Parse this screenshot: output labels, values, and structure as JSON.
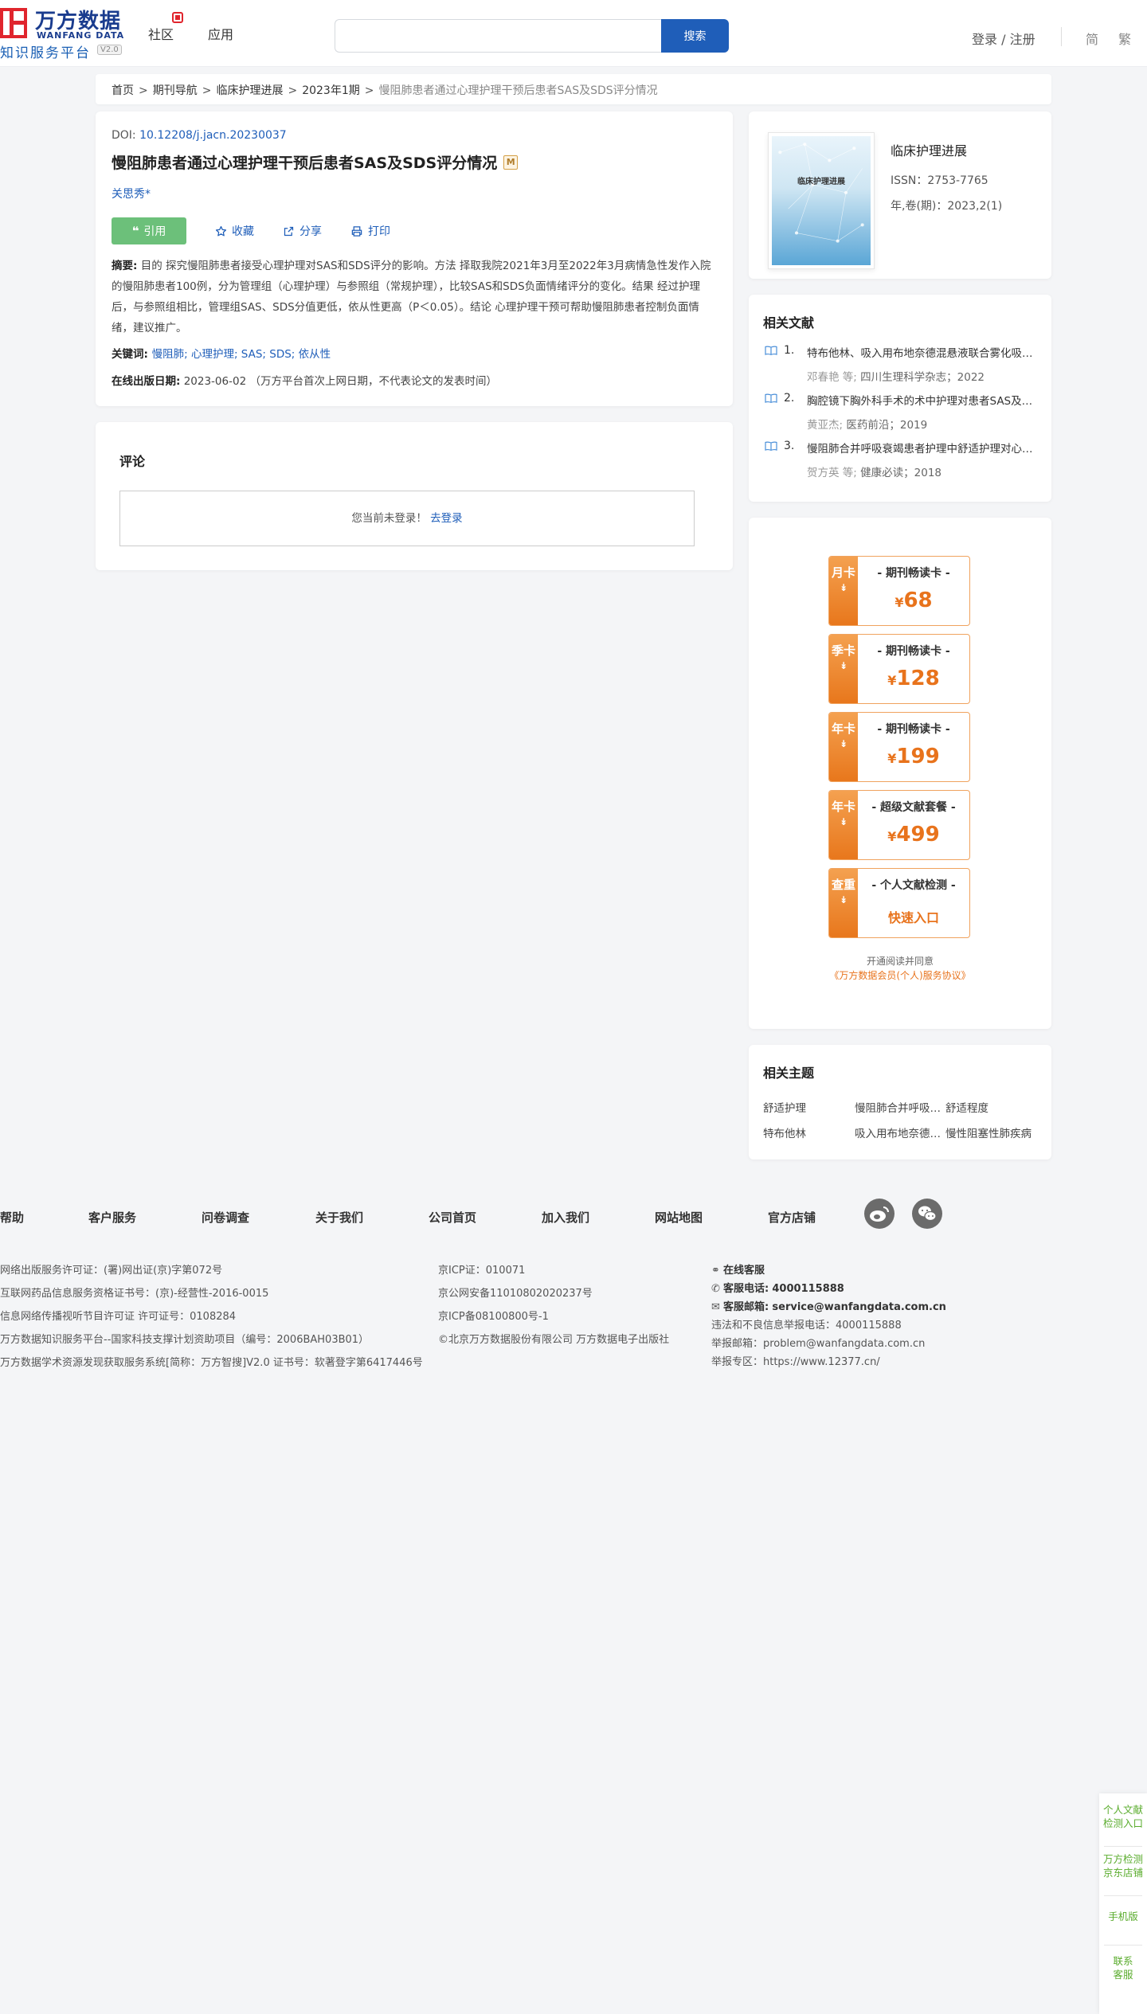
{
  "header": {
    "logo_cn": "万方数据",
    "logo_en": "WANFANG DATA",
    "logo_sub": "知识服务平台",
    "logo_version": "V2.0",
    "nav": [
      "社区",
      "应用"
    ],
    "search_placeholder": "",
    "search_button": "搜索",
    "login": "登录 / 注册",
    "lang_simplified": "简",
    "lang_traditional": "繁"
  },
  "breadcrumb": [
    "首页",
    "期刊导航",
    "临床护理进展",
    "2023年1期",
    "慢阻肺患者通过心理护理干预后患者SAS及SDS评分情况"
  ],
  "article": {
    "doi_label": "DOI: ",
    "doi_value": "10.12208/j.jacn.20230037",
    "title": "慢阻肺患者通过心理护理干预后患者SAS及SDS评分情况",
    "m_badge": "M",
    "author": "关思秀*",
    "cite": "引用",
    "favorite": "收藏",
    "share": "分享",
    "print": "打印",
    "abstract_label": "摘要:",
    "abstract_text": " 目的 探究慢阻肺患者接受心理护理对SAS和SDS评分的影响。方法 择取我院2021年3月至2022年3月病情急性发作入院的慢阻肺患者100例，分为管理组（心理护理）与参照组（常规护理），比较SAS和SDS负面情绪评分的变化。结果 经过护理后，与参照组相比，管理组SAS、SDS分值更低，依从性更高（P＜0.05）。结论 心理护理干预可帮助慢阻肺患者控制负面情绪，建议推广。",
    "keywords_label": "关键词:",
    "keywords": "慢阻肺; 心理护理; SAS; SDS; 依从性",
    "pubdate_label": "在线出版日期:",
    "pubdate_value": "2023-06-02  （万方平台首次上网日期，不代表论文的发表时间）"
  },
  "comment": {
    "title": "评论",
    "notice": "您当前未登录！",
    "login_link": "去登录"
  },
  "journal": {
    "cover_title": "临床护理进展",
    "name": "临床护理进展",
    "issn": "ISSN：2753-7765",
    "volume": "年,卷(期)：2023,2(1)"
  },
  "related_docs": {
    "title": "相关文献",
    "items": [
      {
        "num": "1.",
        "title": "特布他林、吸入用布地奈德混悬液联合雾化吸入治疗慢阻肺",
        "authors": "邓春艳  等;",
        "source": "四川生理科学杂志；2022"
      },
      {
        "num": "2.",
        "title": "胸腔镜下胸外科手术的术中护理对患者SAS及SDS的影响",
        "authors": "黄亚杰;",
        "source": "医药前沿；2019"
      },
      {
        "num": "3.",
        "title": "慢阻肺合并呼吸衰竭患者护理中舒适护理对心理状态的影响",
        "authors": "贺方英  等;",
        "source": "健康必读；2018"
      }
    ]
  },
  "promo": {
    "cards": [
      {
        "side": "月卡",
        "name": "- 期刊畅读卡 -",
        "currency": "¥",
        "price": "68"
      },
      {
        "side": "季卡",
        "name": "- 期刊畅读卡 -",
        "currency": "¥",
        "price": "128"
      },
      {
        "side": "年卡",
        "name": "- 期刊畅读卡 -",
        "currency": "¥",
        "price": "199"
      },
      {
        "side": "年卡",
        "name": "- 超级文献套餐 -",
        "currency": "¥",
        "price": "499"
      },
      {
        "side": "查重",
        "name": "- 个人文献检测 -",
        "quick": "快速入口"
      }
    ],
    "agree_text": "开通阅读并同意",
    "agree_link": "《万方数据会员(个人)服务协议》"
  },
  "topics": {
    "title": "相关主题",
    "items": [
      "舒适护理",
      "慢阻肺合并呼吸衰竭",
      "舒适程度",
      "特布他林",
      "吸入用布地奈德混悬液",
      "慢性阻塞性肺疾病"
    ]
  },
  "footer": {
    "nav": [
      "帮助",
      "客户服务",
      "问卷调查",
      "关于我们",
      "公司首页",
      "加入我们",
      "网站地图",
      "官方店铺"
    ],
    "col1": [
      "网络出版服务许可证：(署)网出证(京)字第072号",
      "互联网药品信息服务资格证书号：(京)-经营性-2016-0015",
      "信息网络传播视听节目许可证 许可证号：0108284",
      "万方数据知识服务平台--国家科技支撑计划资助项目（编号：2006BAH03B01）",
      "万方数据学术资源发现获取服务系统[简称：万方智搜]V2.0 证书号：软著登字第6417446号"
    ],
    "col2": [
      "京ICP证：010071",
      "京公网安备11010802020237号",
      "京ICP备08100800号-1",
      "©北京万方数据股份有限公司 万方数据电子出版社"
    ],
    "online_service": "在线客服",
    "phone_label": "客服电话:",
    "phone": "4000115888",
    "email_label": "客服邮箱:",
    "email": "service@wanfangdata.com.cn",
    "report_phone": "违法和不良信息举报电话：4000115888",
    "report_email": "举报邮箱：problem@wanfangdata.com.cn",
    "report_zone": "举报专区：https://www.12377.cn/"
  },
  "float_bar": {
    "item1": [
      "个人文献",
      "检测入口"
    ],
    "item2": [
      "万方检测",
      "京东店铺"
    ],
    "item3": [
      "手机版"
    ],
    "item4": [
      "联系",
      "客服"
    ]
  },
  "colors": {
    "brand_blue": "#1f5eb9",
    "brand_red": "#e0252d",
    "cite_green": "#6cc07a",
    "promo_orange": "#e8731c",
    "float_green": "#5aac2d"
  }
}
